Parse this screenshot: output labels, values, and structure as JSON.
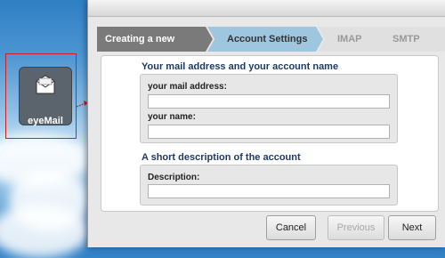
{
  "desktop": {
    "icon_label": "eyeMail"
  },
  "wizard": {
    "steps": [
      {
        "label": "Creating a new account",
        "state": "done"
      },
      {
        "label": "Account Settings",
        "state": "active"
      },
      {
        "label": "IMAP Server",
        "state": "pending"
      },
      {
        "label": "SMTP Server",
        "state": "pending"
      }
    ],
    "section_account": {
      "title": "Your mail address and your account name",
      "mail_label": "your mail address:",
      "mail_value": "",
      "name_label": "your name:",
      "name_value": ""
    },
    "section_description": {
      "title": "A short description of the account",
      "description_label": "Description:",
      "description_value": ""
    },
    "buttons": {
      "cancel": "Cancel",
      "previous": "Previous",
      "next": "Next"
    }
  },
  "colors": {
    "step_done": "#7a7a7a",
    "step_active": "#9ec6de",
    "step_pending": "#e0e0e0",
    "section_title": "#1f3a66",
    "highlight_border": "#cc2222"
  }
}
